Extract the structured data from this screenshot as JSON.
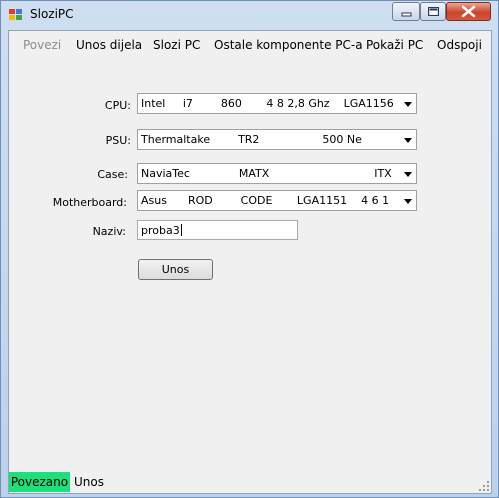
{
  "window": {
    "title": "SloziPC"
  },
  "menu": {
    "items": [
      {
        "label": "Povezi",
        "enabled": false
      },
      {
        "label": "Unos dijela",
        "enabled": true
      },
      {
        "label": "Slozi PC",
        "enabled": true
      },
      {
        "label": "Ostale komponente PC-a",
        "enabled": true
      },
      {
        "label": "Pokaži PC",
        "enabled": true
      },
      {
        "label": "Odspoji",
        "enabled": true
      }
    ]
  },
  "form": {
    "cpu": {
      "label": "CPU:",
      "value": "Intel     i7        860       4 8 2,8 Ghz    LGA1156"
    },
    "psu": {
      "label": "PSU:",
      "value": "Thermaltake        TR2                  500 Ne"
    },
    "case": {
      "label": "Case:",
      "value": "NaviaTec              MATX                              ITX"
    },
    "motherboard": {
      "label": "Motherboard:",
      "value": "Asus      ROD        CODE       LGA1151    4 6 1"
    },
    "naziv": {
      "label": "Naziv:",
      "value": "proba3"
    },
    "submit_label": "Unos"
  },
  "status": {
    "connection": "Povezano",
    "connection_color": "#1ee07a",
    "mode": "Unos"
  },
  "icons": {
    "app": "app-icon",
    "minimize": "minimize-icon",
    "maximize": "maximize-icon",
    "close": "close-icon",
    "dropdown": "chevron-down-icon"
  }
}
